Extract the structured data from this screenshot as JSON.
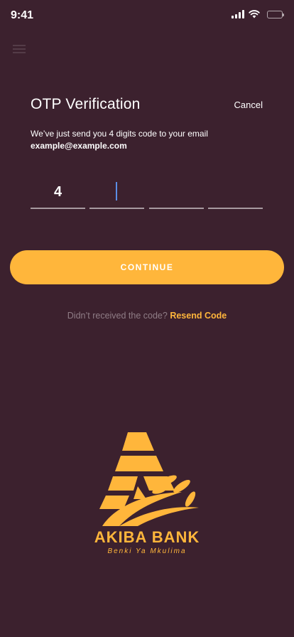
{
  "status_bar": {
    "time": "9:41",
    "icons": [
      "cellular-signal-icon",
      "wifi-icon",
      "battery-icon"
    ]
  },
  "otp": {
    "title": "OTP Verification",
    "cancel_label": "Cancel",
    "subtitle": "We’ve just send you 4 digits code to your email",
    "email": "example@example.com",
    "digits": [
      "4",
      "",
      "",
      ""
    ]
  },
  "actions": {
    "continue_label": "CONTINUE",
    "resend_prompt": "Didn’t received the code?",
    "resend_link": "Resend Code"
  },
  "brand": {
    "name": "AKIBA BANK",
    "tagline": "Benki Ya Mkulima"
  },
  "colors": {
    "background": "#3c212e",
    "accent": "#ffb63b",
    "caret": "#5b8ee6",
    "muted_text": "#8f7d86"
  }
}
